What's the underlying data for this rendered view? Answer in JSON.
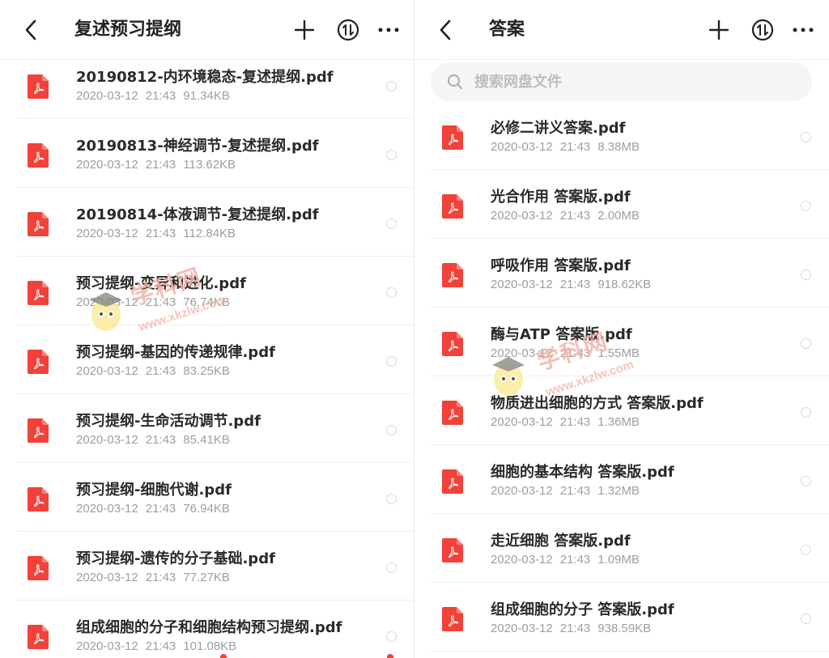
{
  "left_panel": {
    "title": "复述预习提纲",
    "icons": {
      "back": "chevron-left-icon",
      "add": "plus-icon",
      "sort": "sort-icon",
      "more": "more-icon"
    },
    "files": [
      {
        "name": "20190812-内环境稳态-复述提纲.pdf",
        "date": "2020-03-12",
        "time": "21:43",
        "size": "91.34KB"
      },
      {
        "name": "20190813-神经调节-复述提纲.pdf",
        "date": "2020-03-12",
        "time": "21:43",
        "size": "113.62KB"
      },
      {
        "name": "20190814-体液调节-复述提纲.pdf",
        "date": "2020-03-12",
        "time": "21:43",
        "size": "112.84KB"
      },
      {
        "name": "预习提纲-变异和进化.pdf",
        "date": "2020-03-12",
        "time": "21:43",
        "size": "76.74KB"
      },
      {
        "name": "预习提纲-基因的传递规律.pdf",
        "date": "2020-03-12",
        "time": "21:43",
        "size": "83.25KB"
      },
      {
        "name": "预习提纲-生命活动调节.pdf",
        "date": "2020-03-12",
        "time": "21:43",
        "size": "85.41KB"
      },
      {
        "name": "预习提纲-细胞代谢.pdf",
        "date": "2020-03-12",
        "time": "21:43",
        "size": "76.94KB"
      },
      {
        "name": "预习提纲-遗传的分子基础.pdf",
        "date": "2020-03-12",
        "time": "21:43",
        "size": "77.27KB"
      },
      {
        "name": "组成细胞的分子和细胞结构预习提纲.pdf",
        "date": "2020-03-12",
        "time": "21:43",
        "size": "101.08KB"
      }
    ]
  },
  "right_panel": {
    "title": "答案",
    "search_placeholder": "搜索网盘文件",
    "icons": {
      "back": "chevron-left-icon",
      "add": "plus-icon",
      "sort": "sort-icon",
      "more": "more-icon",
      "search": "search-icon"
    },
    "files": [
      {
        "name": "必修二讲义答案.pdf",
        "date": "2020-03-12",
        "time": "21:43",
        "size": "8.38MB"
      },
      {
        "name": "光合作用 答案版.pdf",
        "date": "2020-03-12",
        "time": "21:43",
        "size": "2.00MB"
      },
      {
        "name": "呼吸作用 答案版.pdf",
        "date": "2020-03-12",
        "time": "21:43",
        "size": "918.62KB"
      },
      {
        "name": "酶与ATP 答案版.pdf",
        "date": "2020-03-12",
        "time": "21:43",
        "size": "1.55MB"
      },
      {
        "name": "物质进出细胞的方式 答案版.pdf",
        "date": "2020-03-12",
        "time": "21:43",
        "size": "1.36MB"
      },
      {
        "name": "细胞的基本结构 答案版.pdf",
        "date": "2020-03-12",
        "time": "21:43",
        "size": "1.32MB"
      },
      {
        "name": "走近细胞 答案版.pdf",
        "date": "2020-03-12",
        "time": "21:43",
        "size": "1.09MB"
      },
      {
        "name": "组成细胞的分子 答案版.pdf",
        "date": "2020-03-12",
        "time": "21:43",
        "size": "938.59KB"
      }
    ]
  },
  "watermark": {
    "text": "学科网",
    "url": "www.xkzlw.com"
  },
  "colors": {
    "pdf_red": "#f0423a",
    "title": "#222222",
    "meta": "#9e9e9e"
  }
}
